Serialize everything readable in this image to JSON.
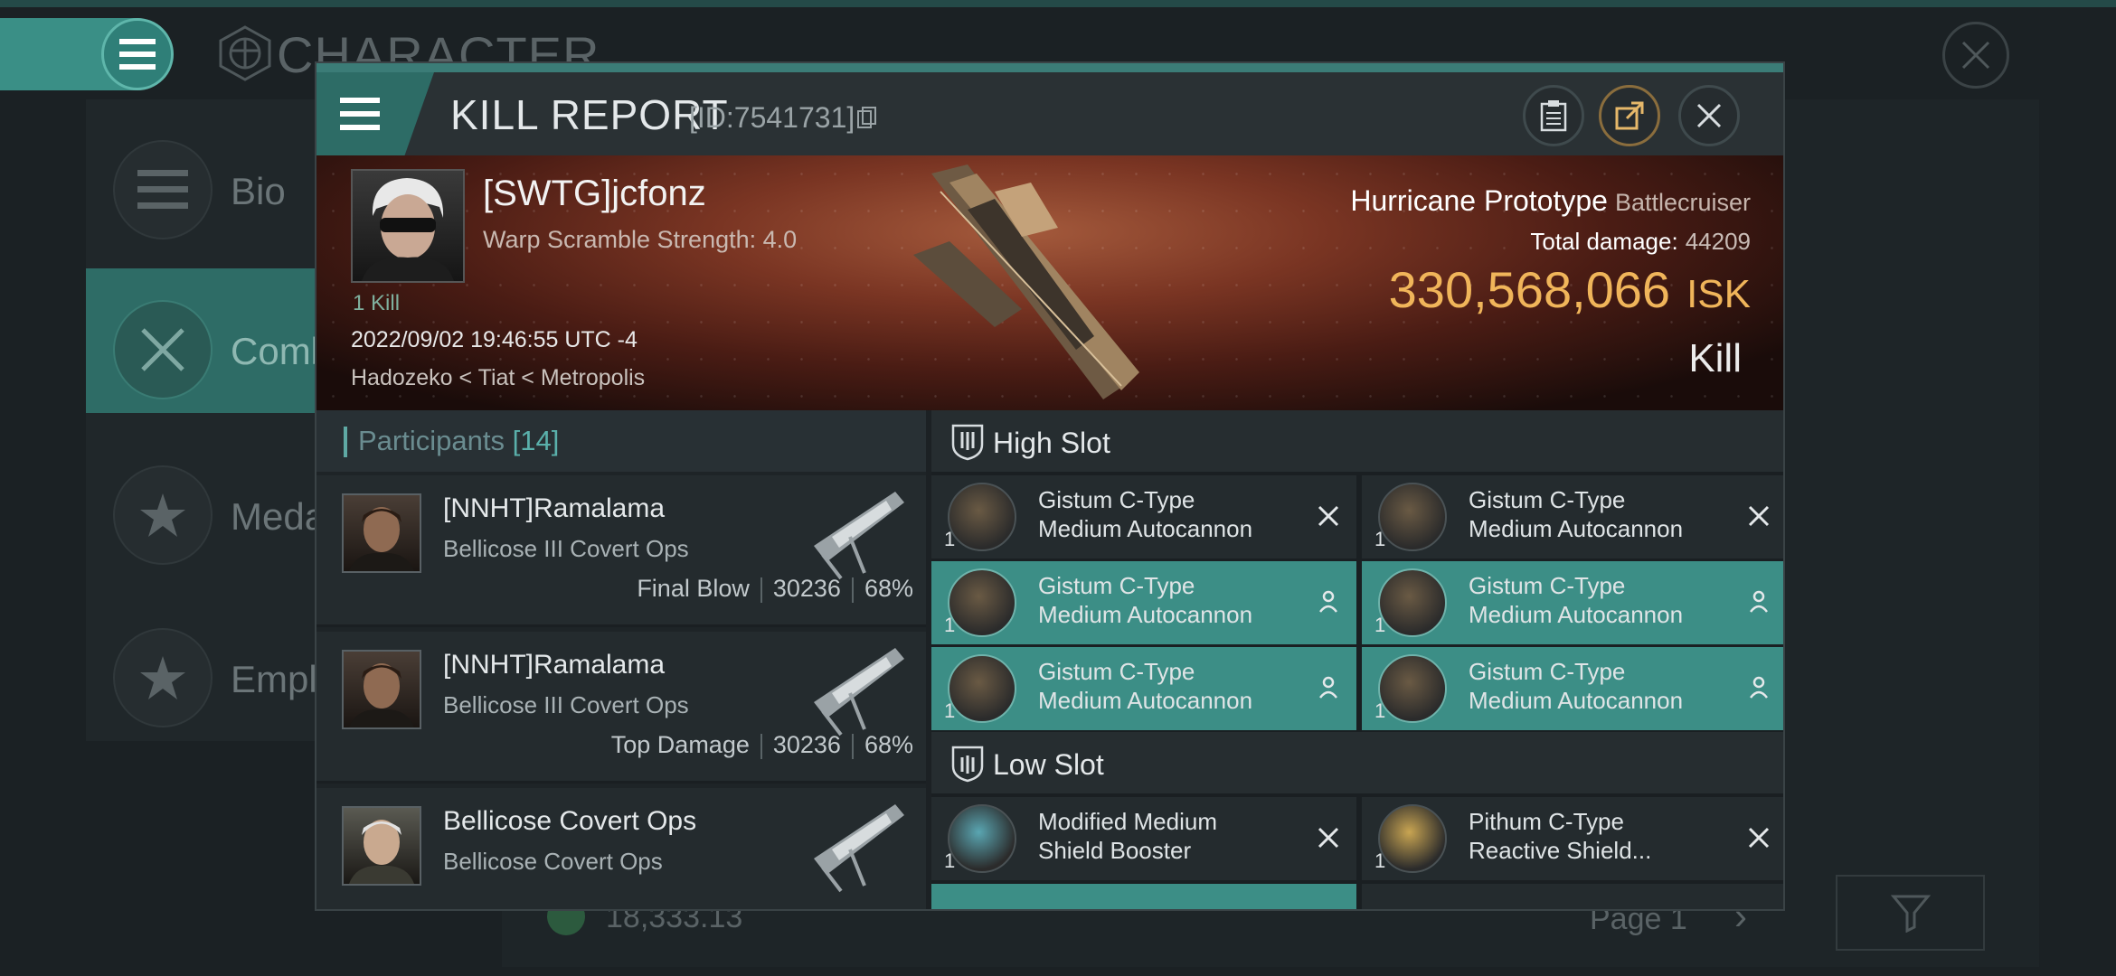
{
  "background": {
    "title": "CHARACTER",
    "nav": [
      {
        "label": "Bio",
        "icon": "list-icon"
      },
      {
        "label": "Combat",
        "icon": "crossed-swords-icon"
      },
      {
        "label": "Medals",
        "icon": "star-badge-icon"
      },
      {
        "label": "Employment",
        "icon": "star-circle-icon"
      }
    ],
    "balance": "18,333.13",
    "page": "Page 1"
  },
  "modal": {
    "title": "KILL REPORT",
    "id_label": "[ID:7541731]"
  },
  "victim": {
    "name": "[SWTG]jcfonz",
    "subtitle": "Warp Scramble Strength: 4.0",
    "kills": "1 Kill",
    "time": "2022/09/02 19:46:55 UTC -4",
    "location": "Hadozeko < Tiat < Metropolis",
    "ship": "Hurricane Prototype",
    "ship_class": "Battlecruiser",
    "damage_label": "Total damage:",
    "damage_value": "44209",
    "isk_value": "330,568,066",
    "isk_unit": "ISK",
    "result": "Kill"
  },
  "participants": {
    "label": "Participants",
    "count": "[14]",
    "rows": [
      {
        "name": "[NNHT]Ramalama",
        "ship": "Bellicose III Covert Ops",
        "role": "Final Blow",
        "damage": "30236",
        "percent": "68%"
      },
      {
        "name": "[NNHT]Ramalama",
        "ship": "Bellicose III Covert Ops",
        "role": "Top Damage",
        "damage": "30236",
        "percent": "68%"
      },
      {
        "name": "Bellicose Covert Ops",
        "ship": "Bellicose Covert Ops",
        "role": "",
        "damage": "",
        "percent": ""
      }
    ]
  },
  "high_slot": {
    "title": "High Slot",
    "items": [
      {
        "qty": "1",
        "l1": "Gistum C-Type",
        "l2": "Medium Autocannon",
        "state": "destroyed"
      },
      {
        "qty": "1",
        "l1": "Gistum C-Type",
        "l2": "Medium Autocannon",
        "state": "destroyed"
      },
      {
        "qty": "1",
        "l1": "Gistum C-Type",
        "l2": "Medium Autocannon",
        "state": "dropped"
      },
      {
        "qty": "1",
        "l1": "Gistum C-Type",
        "l2": "Medium Autocannon",
        "state": "dropped"
      },
      {
        "qty": "1",
        "l1": "Gistum C-Type",
        "l2": "Medium Autocannon",
        "state": "dropped"
      },
      {
        "qty": "1",
        "l1": "Gistum C-Type",
        "l2": "Medium Autocannon",
        "state": "dropped"
      }
    ]
  },
  "low_slot": {
    "title": "Low Slot",
    "items": [
      {
        "qty": "1",
        "l1": "Modified Medium",
        "l2": "Shield Booster",
        "state": "destroyed"
      },
      {
        "qty": "1",
        "l1": "Pithum C-Type",
        "l2": "Reactive Shield...",
        "state": "destroyed"
      }
    ]
  },
  "colors": {
    "accent": "#3c8e86",
    "isk": "#f0b55a",
    "panel": "#1c2124"
  }
}
